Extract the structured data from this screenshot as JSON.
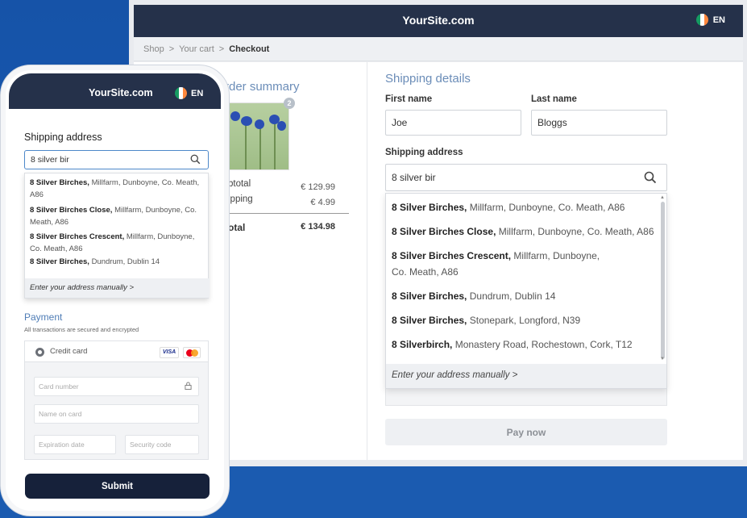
{
  "desktop": {
    "header": {
      "site": "YourSite.com",
      "lang": "EN"
    },
    "breadcrumb": {
      "shop": "Shop",
      "cart": "Your cart",
      "current": "Checkout",
      "sep": ">"
    },
    "order_summary": {
      "title": "Order summary",
      "title_visible": "rder summary",
      "quantity_badge": "2",
      "subtotal_label": "btotal",
      "subtotal_value": "€ 129.99",
      "shipping_label": "ipping",
      "shipping_value": "€ 4.99",
      "total_label": "otal",
      "total_value": "€ 134.98"
    },
    "shipping": {
      "title": "Shipping details",
      "first_name_label": "First name",
      "first_name_value": "Joe",
      "last_name_label": "Last name",
      "last_name_value": "Bloggs",
      "address_label": "Shipping address",
      "address_value": "8 silver bir"
    },
    "suggestions": [
      {
        "main": "8 Silver Birches,",
        "rest": " Millfarm, Dunboyne, Co. Meath, A86"
      },
      {
        "main": "8 Silver Birches  Close,",
        "rest": " Millfarm, Dunboyne, Co. Meath, A86"
      },
      {
        "main": "8 Silver Birches Crescent,",
        "rest": " Millfarm, Dunboyne,",
        "rest2": "Co. Meath, A86"
      },
      {
        "main": "8 Silver Birches,",
        "rest": " Dundrum, Dublin 14"
      },
      {
        "main": "8 Silver Birches,",
        "rest": " Stonepark, Longford, N39"
      },
      {
        "main": "8 Silverbirch,",
        "rest": " Monastery Road, Rochestown, Cork, T12"
      }
    ],
    "manual_link": "Enter your address manually >",
    "pay_button": "Pay now"
  },
  "phone": {
    "header": {
      "site": "YourSite.com",
      "lang": "EN"
    },
    "address_label": "Shipping address",
    "address_value": "8 silver bir",
    "suggestions": [
      {
        "main": "8 Silver Birches,",
        "rest": " Millfarm, Dunboyne, Co. Meath, A86"
      },
      {
        "main": "8 Silver Birches Close,",
        "rest": " Millfarm, Dunboyne, Co. Meath, A86"
      },
      {
        "main": "8 Silver Birches Crescent,",
        "rest": " Millfarm, Dunboyne, Co. Meath, A86"
      },
      {
        "main": "8 Silver Birches,",
        "rest": " Dundrum, Dublin 14"
      }
    ],
    "manual_link": "Enter your address manually >",
    "payment_title": "Payment",
    "payment_note": "All transactions are secured and encrypted",
    "credit_card_label": "Credit card",
    "visa_label": "VISA",
    "card_number_placeholder": "Card number",
    "name_placeholder": "Name on card",
    "expiry_placeholder": "Expiration date",
    "security_placeholder": "Security code",
    "submit_button": "Submit"
  },
  "colors": {
    "background": "#1b5ab1",
    "header": "#25314a",
    "accent": "#6b8db8",
    "submit": "#16213a"
  },
  "icons": [
    "search-icon",
    "lock-icon",
    "ireland-flag-icon",
    "chevron-right-icon",
    "radio-icon",
    "visa-icon",
    "mastercard-icon"
  ]
}
